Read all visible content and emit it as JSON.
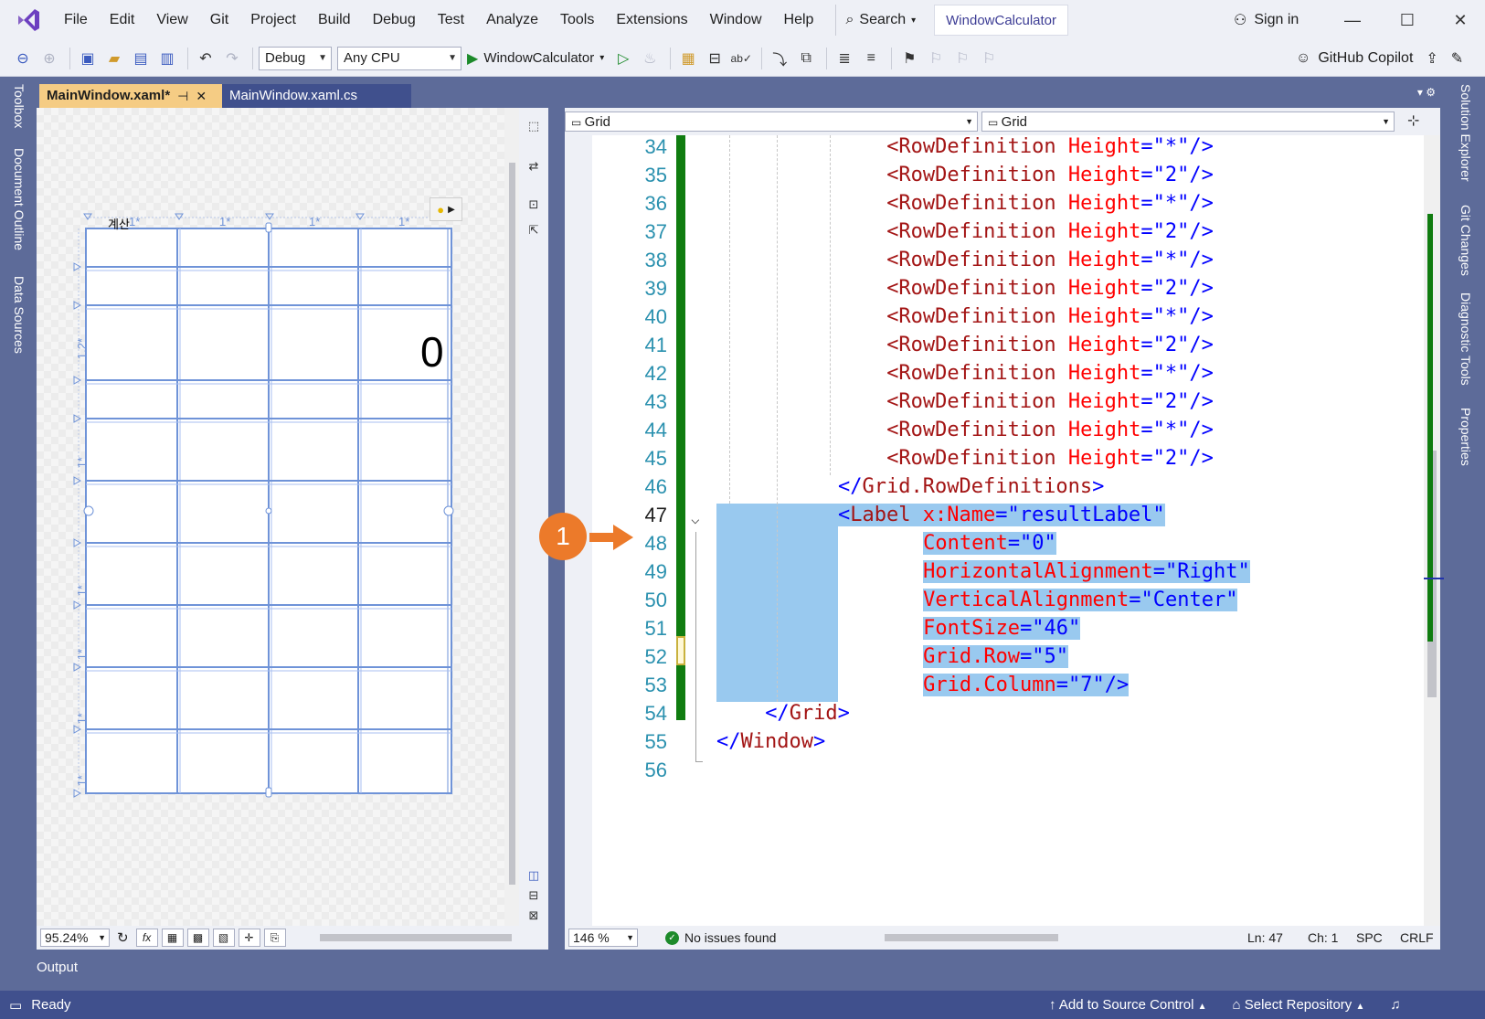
{
  "menubar": {
    "items": [
      "File",
      "Edit",
      "View",
      "Git",
      "Project",
      "Build",
      "Debug",
      "Test",
      "Analyze",
      "Tools",
      "Extensions",
      "Window",
      "Help"
    ],
    "search_label": "Search",
    "solution_name": "WindowCalculator",
    "signin_label": "Sign in"
  },
  "toolbar": {
    "config": "Debug",
    "platform": "Any CPU",
    "start_target": "WindowCalculator",
    "copilot_label": "GitHub Copilot"
  },
  "left_strip": {
    "tabs": [
      "Toolbox",
      "Document Outline",
      "Data Sources"
    ]
  },
  "right_strip": {
    "tabs": [
      "Solution Explorer",
      "Git Changes",
      "Diagnostic Tools",
      "Properties"
    ]
  },
  "doc_tabs": [
    {
      "label": "MainWindow.xaml*",
      "active": true
    },
    {
      "label": "MainWindow.xaml.cs",
      "active": false
    }
  ],
  "designer": {
    "title_text": "계산",
    "column_labels": [
      "1*",
      "1*",
      "1*",
      "1*"
    ],
    "row_labels": [
      "1.2*",
      "1*",
      "1*",
      "1*",
      "1*",
      "1*"
    ],
    "result_text": "0",
    "zoom": "95.24%"
  },
  "nav": {
    "left": "Grid",
    "right": "Grid"
  },
  "editor": {
    "lines": [
      {
        "n": "34",
        "indent": 14,
        "parts": [
          [
            "t-tag",
            "<RowDefinition "
          ],
          [
            "t-attr",
            "Height"
          ],
          [
            "t-punct",
            "=\"*\"/>"
          ]
        ]
      },
      {
        "n": "35",
        "indent": 14,
        "parts": [
          [
            "t-tag",
            "<RowDefinition "
          ],
          [
            "t-attr",
            "Height"
          ],
          [
            "t-punct",
            "=\"2\"/>"
          ]
        ]
      },
      {
        "n": "36",
        "indent": 14,
        "parts": [
          [
            "t-tag",
            "<RowDefinition "
          ],
          [
            "t-attr",
            "Height"
          ],
          [
            "t-punct",
            "=\"*\"/>"
          ]
        ]
      },
      {
        "n": "37",
        "indent": 14,
        "parts": [
          [
            "t-tag",
            "<RowDefinition "
          ],
          [
            "t-attr",
            "Height"
          ],
          [
            "t-punct",
            "=\"2\"/>"
          ]
        ]
      },
      {
        "n": "38",
        "indent": 14,
        "parts": [
          [
            "t-tag",
            "<RowDefinition "
          ],
          [
            "t-attr",
            "Height"
          ],
          [
            "t-punct",
            "=\"*\"/>"
          ]
        ]
      },
      {
        "n": "39",
        "indent": 14,
        "parts": [
          [
            "t-tag",
            "<RowDefinition "
          ],
          [
            "t-attr",
            "Height"
          ],
          [
            "t-punct",
            "=\"2\"/>"
          ]
        ]
      },
      {
        "n": "40",
        "indent": 14,
        "parts": [
          [
            "t-tag",
            "<RowDefinition "
          ],
          [
            "t-attr",
            "Height"
          ],
          [
            "t-punct",
            "=\"*\"/>"
          ]
        ]
      },
      {
        "n": "41",
        "indent": 14,
        "parts": [
          [
            "t-tag",
            "<RowDefinition "
          ],
          [
            "t-attr",
            "Height"
          ],
          [
            "t-punct",
            "=\"2\"/>"
          ]
        ]
      },
      {
        "n": "42",
        "indent": 14,
        "parts": [
          [
            "t-tag",
            "<RowDefinition "
          ],
          [
            "t-attr",
            "Height"
          ],
          [
            "t-punct",
            "=\"*\"/>"
          ]
        ]
      },
      {
        "n": "43",
        "indent": 14,
        "parts": [
          [
            "t-tag",
            "<RowDefinition "
          ],
          [
            "t-attr",
            "Height"
          ],
          [
            "t-punct",
            "=\"2\"/>"
          ]
        ]
      },
      {
        "n": "44",
        "indent": 14,
        "parts": [
          [
            "t-tag",
            "<RowDefinition "
          ],
          [
            "t-attr",
            "Height"
          ],
          [
            "t-punct",
            "=\"*\"/>"
          ]
        ]
      },
      {
        "n": "45",
        "indent": 14,
        "parts": [
          [
            "t-tag",
            "<RowDefinition "
          ],
          [
            "t-attr",
            "Height"
          ],
          [
            "t-punct",
            "=\"2\"/>"
          ]
        ]
      },
      {
        "n": "46",
        "indent": 10,
        "parts": [
          [
            "t-punct",
            "</"
          ],
          [
            "t-tag",
            "Grid.RowDefinitions"
          ],
          [
            "t-punct",
            ">"
          ]
        ]
      },
      {
        "n": "47",
        "indent": 10,
        "sel": true,
        "current": true,
        "parts": [
          [
            "t-punct",
            "<"
          ],
          [
            "t-tag",
            "Label "
          ],
          [
            "t-attr",
            "x:Name"
          ],
          [
            "t-punct",
            "=\"resultLabel\""
          ]
        ]
      },
      {
        "n": "48",
        "indent": 17,
        "sel": true,
        "parts": [
          [
            "t-attr",
            "Content"
          ],
          [
            "t-punct",
            "=\"0\""
          ]
        ]
      },
      {
        "n": "49",
        "indent": 17,
        "sel": true,
        "parts": [
          [
            "t-attr",
            "HorizontalAlignment"
          ],
          [
            "t-punct",
            "=\"Right\""
          ]
        ]
      },
      {
        "n": "50",
        "indent": 17,
        "sel": true,
        "parts": [
          [
            "t-attr",
            "VerticalAlignment"
          ],
          [
            "t-punct",
            "=\"Center\""
          ]
        ]
      },
      {
        "n": "51",
        "indent": 17,
        "sel": true,
        "parts": [
          [
            "t-attr",
            "FontSize"
          ],
          [
            "t-punct",
            "=\"46\""
          ]
        ]
      },
      {
        "n": "52",
        "indent": 17,
        "sel": true,
        "parts": [
          [
            "t-attr",
            "Grid.Row"
          ],
          [
            "t-punct",
            "=\"5\""
          ]
        ]
      },
      {
        "n": "53",
        "indent": 17,
        "sel": true,
        "parts": [
          [
            "t-attr",
            "Grid.Column"
          ],
          [
            "t-punct",
            "=\"7\"/>"
          ]
        ]
      },
      {
        "n": "54",
        "indent": 4,
        "parts": [
          [
            "t-punct",
            "</"
          ],
          [
            "t-tag",
            "Grid"
          ],
          [
            "t-punct",
            ">"
          ]
        ]
      },
      {
        "n": "55",
        "indent": 0,
        "parts": [
          [
            "t-punct",
            "</"
          ],
          [
            "t-tag",
            "Window"
          ],
          [
            "t-punct",
            ">"
          ]
        ]
      },
      {
        "n": "56",
        "indent": 0,
        "parts": []
      }
    ],
    "zoom": "146 %",
    "issues": "No issues found",
    "ln": "Ln: 47",
    "ch": "Ch: 1",
    "spc": "SPC",
    "crlf": "CRLF"
  },
  "callout": {
    "number": "1"
  },
  "output_label": "Output",
  "status": {
    "ready": "Ready",
    "add_source": "Add to Source Control",
    "select_repo": "Select Repository"
  },
  "colors": {
    "accent": "#5d6b99",
    "status_bar": "#40508d",
    "tab_active": "#f5cc84",
    "selection": "#99c9ef",
    "change_bar": "#107c10",
    "callout": "#ec7a2a"
  }
}
